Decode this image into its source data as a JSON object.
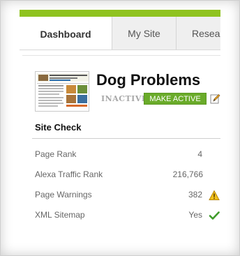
{
  "tabs": [
    {
      "label": "Dashboard",
      "active": true
    },
    {
      "label": "My Site",
      "active": false
    },
    {
      "label": "Resear",
      "active": false
    }
  ],
  "site": {
    "name": "Dog Problems",
    "status": "INACTIVE",
    "activate_label": "MAKE ACTIVE"
  },
  "site_check": {
    "title": "Site Check",
    "rows": [
      {
        "label": "Page Rank",
        "value": "4",
        "icon": ""
      },
      {
        "label": "Alexa Traffic Rank",
        "value": "216,766",
        "icon": ""
      },
      {
        "label": "Page Warnings",
        "value": "382",
        "icon": "warning-icon"
      },
      {
        "label": "XML Sitemap",
        "value": "Yes",
        "icon": "check-icon"
      }
    ]
  },
  "colors": {
    "accent_green": "#8fc31f",
    "button_green": "#6aab2a",
    "warning_yellow": "#f2c21b",
    "check_green": "#3f9b2a"
  }
}
